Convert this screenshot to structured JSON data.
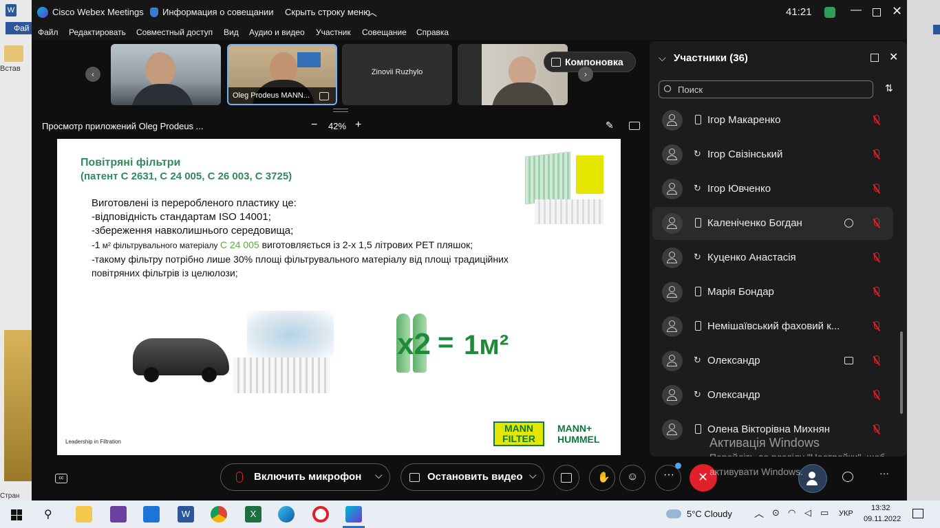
{
  "app": {
    "title": "Cisco Webex Meetings",
    "meeting_info": "Информация о совещании",
    "hide_menu": "Скрыть строку меню",
    "timer": "41:21"
  },
  "word_bg": {
    "file_tab": "Фай",
    "insert_label": "Встав",
    "status_label": "Стран"
  },
  "menu": [
    "Файл",
    "Редактировать",
    "Совместный доступ",
    "Вид",
    "Аудио и видео",
    "Участник",
    "Совещание",
    "Справка"
  ],
  "thumbnails": [
    {
      "label": ""
    },
    {
      "label": "Oleg Prodeus MANN..."
    },
    {
      "label": "Zinovii Ruzhylo"
    },
    {
      "label": ""
    }
  ],
  "layout_button": "Компоновка",
  "share": {
    "title": "Просмотр приложений Oleg Prodeus ...",
    "zoom": "42%",
    "zoom_out": "−",
    "zoom_in": "+"
  },
  "slide": {
    "title_line1": "Повітряні фільтри",
    "title_line2": "(патент C 2631, C 24 005, C 26 003, C 3725)",
    "body": [
      "Виготовлені із переробленого пластику це:",
      "-відповідність стандартам ISO 14001;",
      "-збереження навколишнього середовища;"
    ],
    "line4_a": "-1",
    "line4_b": " м² фільтрувального матеріалу ",
    "line4_c": "C 24 005",
    "line4_d": " виготовляється із 2-х 1,5 літрових PET пляшок;",
    "line5": "-такому фільтру потрібно лише 30% площі фільтрувального матеріалу від площі традиційних",
    "line6": "повітряних фільтрів із целюлози;",
    "x2": "x2",
    "equals": "=",
    "result": "1м²",
    "footer": "Leadership in Filtration",
    "mann_filter_1": "MANN",
    "mann_filter_2": "FILTER",
    "mh_1": "MANN+",
    "mh_2": "HUMMEL"
  },
  "panel": {
    "title": "Участники (36)",
    "search_placeholder": "Поиск",
    "participants": [
      {
        "name": "Ігор Макаренко",
        "device": "phone",
        "extra": ""
      },
      {
        "name": "Ігор Свізінський",
        "device": "sync",
        "extra": ""
      },
      {
        "name": "Ігор Ювченко",
        "device": "sync",
        "extra": ""
      },
      {
        "name": "Каленіченко Богдан",
        "device": "phone",
        "extra": "chat"
      },
      {
        "name": "Куценко Анастасія",
        "device": "sync",
        "extra": ""
      },
      {
        "name": "Марія Бондар",
        "device": "phone",
        "extra": ""
      },
      {
        "name": "Немішаївський фаховий к...",
        "device": "phone",
        "extra": ""
      },
      {
        "name": "Олександр",
        "device": "sync",
        "extra": "video"
      },
      {
        "name": "Олександр",
        "device": "sync",
        "extra": ""
      },
      {
        "name": "Олена Вікторівна Михнян",
        "device": "phone",
        "extra": ""
      }
    ]
  },
  "controls": {
    "mic": "Включить микрофон",
    "video": "Остановить видео"
  },
  "activation": {
    "title": "Активація Windows",
    "line1": "Перейдіть до розділу \"Настройки\", щоб",
    "line2": "активувати Windows."
  },
  "taskbar": {
    "weather": "5°C  Cloudy",
    "lang": "УКР",
    "time": "13:32",
    "date": "09.11.2022"
  },
  "colors": {
    "slide_green": "#2f8a5c",
    "mann_yellow": "#e5e600",
    "mann_green": "#0b7a3a",
    "end_red": "#e0202a"
  }
}
